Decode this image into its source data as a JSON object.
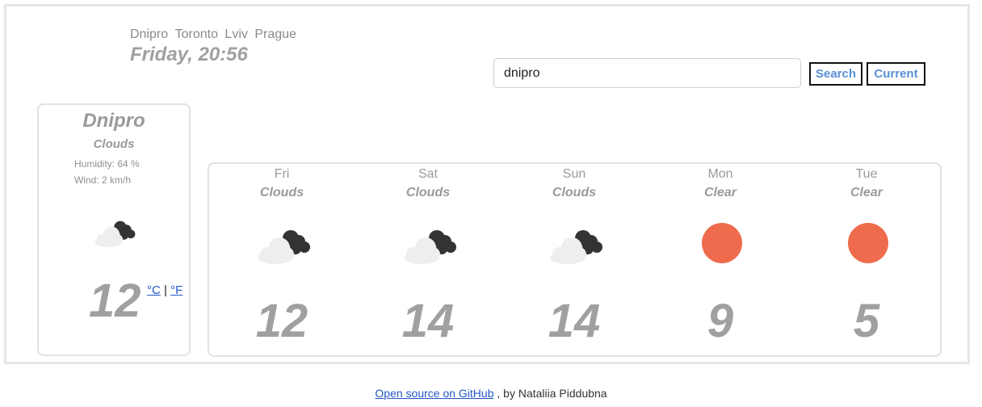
{
  "header": {
    "cities": [
      "Dnipro",
      "Toronto",
      "Lviv",
      "Prague"
    ],
    "date": "Friday, 20:56"
  },
  "search": {
    "value": "dnipro",
    "search_label": "Search",
    "current_label": "Current"
  },
  "today": {
    "city": "Dnipro",
    "description": "Clouds",
    "humidity": "Humidity: 64 %",
    "wind": "Wind: 2 km/h",
    "icon": "clouds-icon",
    "temperature": "12",
    "unit_c": "°C",
    "unit_sep": "|",
    "unit_f": "°F"
  },
  "forecast": [
    {
      "day": "Fri",
      "description": "Clouds",
      "icon": "clouds-icon",
      "temp": "12"
    },
    {
      "day": "Sat",
      "description": "Clouds",
      "icon": "clouds-icon",
      "temp": "14"
    },
    {
      "day": "Sun",
      "description": "Clouds",
      "icon": "clouds-icon",
      "temp": "14"
    },
    {
      "day": "Mon",
      "description": "Clear",
      "icon": "sun-icon",
      "temp": "9"
    },
    {
      "day": "Tue",
      "description": "Clear",
      "icon": "sun-icon",
      "temp": "5"
    }
  ],
  "footer": {
    "link_text": "Open source on GitHub",
    "suffix": " , by Nataliia Piddubna"
  },
  "colors": {
    "sun": "#ee6c4d",
    "cloud_dark": "#333333",
    "cloud_light": "#eeeeee",
    "link": "#2257c8",
    "button_text": "#5a8fd6"
  }
}
